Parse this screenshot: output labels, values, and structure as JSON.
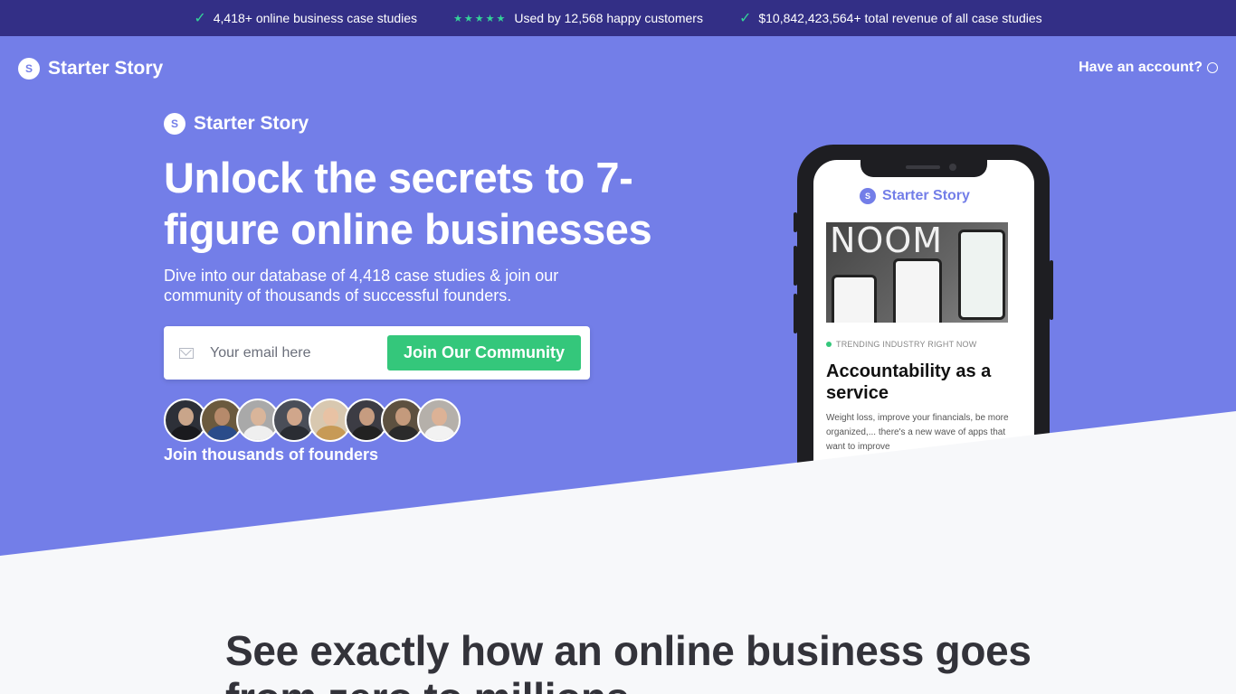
{
  "topbar": {
    "case_studies": "4,418+ online business case studies",
    "customers": "Used by 12,568 happy customers",
    "revenue": "$10,842,423,564+ total revenue of all case studies"
  },
  "nav": {
    "logo_letter": "S",
    "brand": "Starter Story",
    "account": "Have an account?"
  },
  "hero": {
    "logo_letter": "S",
    "brand": "Starter Story",
    "headline": "Unlock the secrets to 7-figure online businesses",
    "subhead": "Dive into our database of 4,418 case studies & join our community of thousands of successful founders.",
    "email_placeholder": "Your email here",
    "join_button": "Join Our Community",
    "founders_label": "Join thousands of founders"
  },
  "phone": {
    "logo_letter": "S",
    "brand": "Starter Story",
    "image_word": "NOOM",
    "trending": "TRENDING INDUSTRY RIGHT NOW",
    "title": "Accountability as a service",
    "description": "Weight loss, improve your financials, be more organized,... there's a new wave of apps that want to improve"
  },
  "section": {
    "title": "See exactly how an online business goes from zero to millions"
  },
  "colors": {
    "topbar": "#332f86",
    "hero": "#737ee8",
    "cta": "#34c77b",
    "page": "#f7f8fa"
  }
}
